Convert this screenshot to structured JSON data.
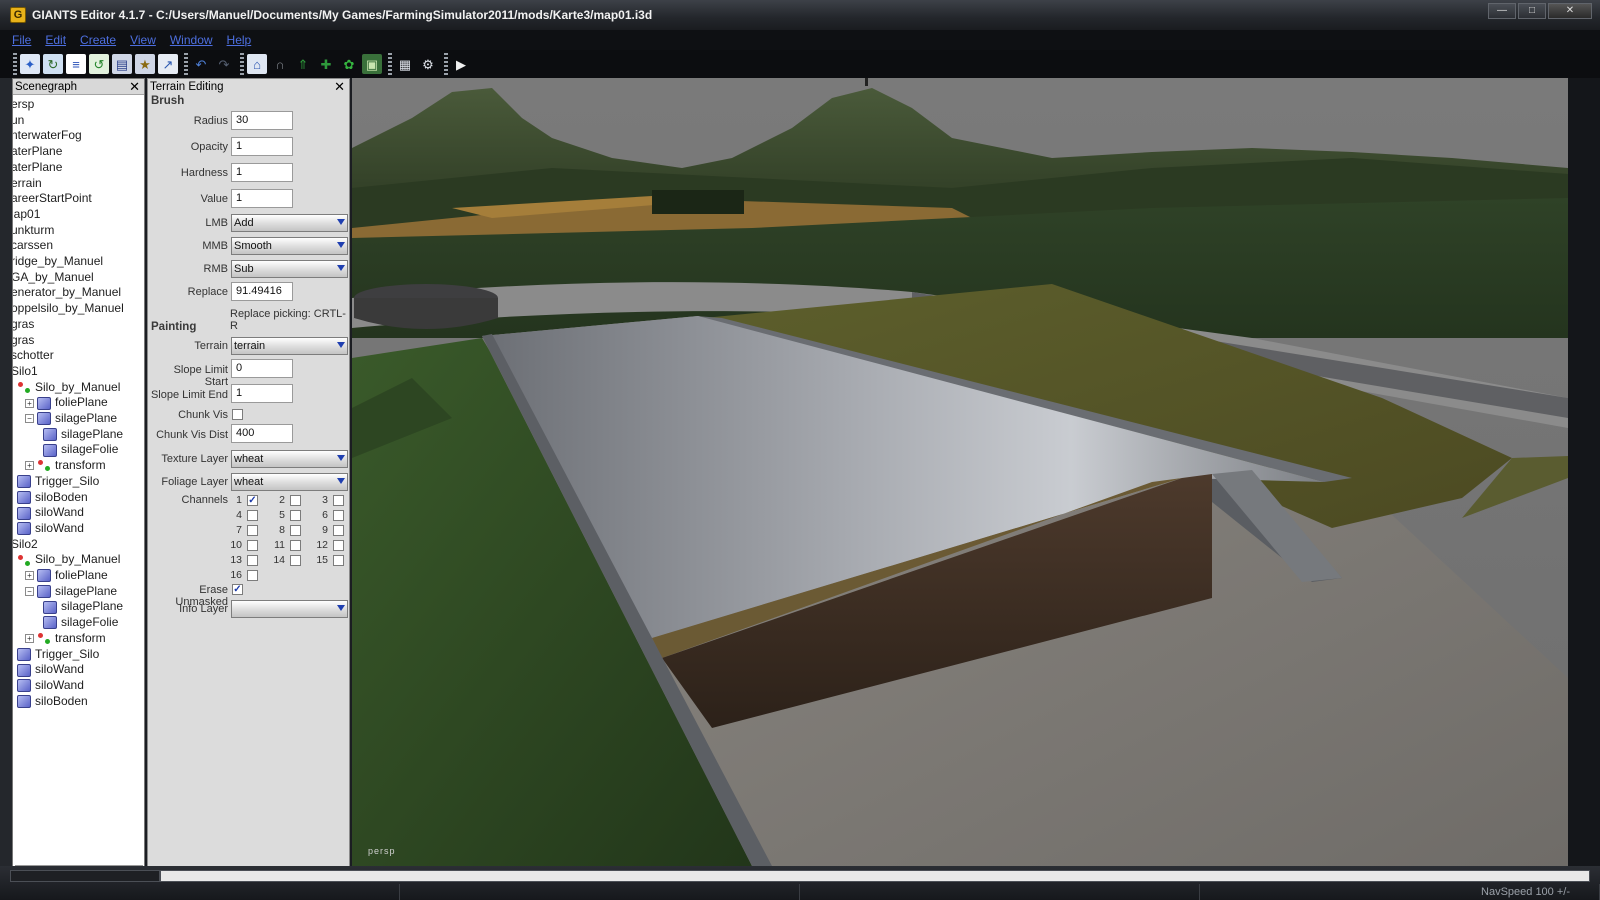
{
  "window": {
    "title": "GIANTS Editor 4.1.7 - C:/Users/Manuel/Documents/My Games/FarmingSimulator2011/mods/Karte3/map01.i3d",
    "app_icon": "giants-editor-icon"
  },
  "menu": [
    "File",
    "Edit",
    "Create",
    "View",
    "Window",
    "Help"
  ],
  "toolbar": {
    "icons": [
      "new-file-icon",
      "open-file-icon",
      "document-icon",
      "refresh-icon",
      "save-icon",
      "save-all-icon",
      "import-icon",
      "undo-icon",
      "redo-icon",
      "home-icon",
      "magnet-icon",
      "terrain-raise-icon",
      "terrain-lower-icon",
      "foliage-icon",
      "tractor-icon",
      "grid-icon",
      "settings-icon",
      "play-icon"
    ]
  },
  "scenegraph": {
    "title": "Scenegraph",
    "items": [
      {
        "label": "ersp",
        "icon": "",
        "depth": 0
      },
      {
        "label": "un",
        "icon": "",
        "depth": 0
      },
      {
        "label": "nterwaterFog",
        "icon": "",
        "depth": 0
      },
      {
        "label": "aterPlane",
        "icon": "",
        "depth": 0
      },
      {
        "label": "aterPlane",
        "icon": "",
        "depth": 0
      },
      {
        "label": "errain",
        "icon": "",
        "depth": 0
      },
      {
        "label": "areerStartPoint",
        "icon": "",
        "depth": 0
      },
      {
        "label": "lap01",
        "icon": "",
        "depth": 0
      },
      {
        "label": "unkturm",
        "icon": "",
        "depth": 0
      },
      {
        "label": "carssen",
        "icon": "",
        "depth": 0
      },
      {
        "label": "ridge_by_Manuel",
        "icon": "",
        "depth": 0
      },
      {
        "label": "GA_by_Manuel",
        "icon": "",
        "depth": 0
      },
      {
        "label": "enerator_by_Manuel",
        "icon": "",
        "depth": 0
      },
      {
        "label": "oppelsilo_by_Manuel",
        "icon": "",
        "depth": 0
      },
      {
        "label": "gras",
        "icon": "",
        "depth": 0
      },
      {
        "label": "gras",
        "icon": "",
        "depth": 0
      },
      {
        "label": "schotter",
        "icon": "",
        "depth": 0
      },
      {
        "label": "Silo1",
        "icon": "",
        "depth": 0
      },
      {
        "label": "Silo_by_Manuel",
        "icon": "transform-group-icon",
        "depth": 1
      },
      {
        "label": "foliePlane",
        "icon": "mesh-cube-icon",
        "depth": 2,
        "expander": "+"
      },
      {
        "label": "silagePlane",
        "icon": "mesh-cube-icon",
        "depth": 2,
        "expander": "-"
      },
      {
        "label": "silagePlane",
        "icon": "mesh-cube-icon",
        "depth": 3
      },
      {
        "label": "silageFolie",
        "icon": "mesh-cube-icon",
        "depth": 3
      },
      {
        "label": "transform",
        "icon": "transform-group-icon",
        "depth": 2,
        "expander": "+"
      },
      {
        "label": "Trigger_Silo",
        "icon": "mesh-cube-icon",
        "depth": 1
      },
      {
        "label": "siloBoden",
        "icon": "mesh-cube-icon",
        "depth": 1
      },
      {
        "label": "siloWand",
        "icon": "mesh-cube-icon",
        "depth": 1
      },
      {
        "label": "siloWand",
        "icon": "mesh-cube-icon",
        "depth": 1
      },
      {
        "label": "Silo2",
        "icon": "",
        "depth": 0
      },
      {
        "label": "Silo_by_Manuel",
        "icon": "transform-group-icon",
        "depth": 1
      },
      {
        "label": "foliePlane",
        "icon": "mesh-cube-icon",
        "depth": 2,
        "expander": "+"
      },
      {
        "label": "silagePlane",
        "icon": "mesh-cube-icon",
        "depth": 2,
        "expander": "-"
      },
      {
        "label": "silagePlane",
        "icon": "mesh-cube-icon",
        "depth": 3
      },
      {
        "label": "silageFolie",
        "icon": "mesh-cube-icon",
        "depth": 3
      },
      {
        "label": "transform",
        "icon": "transform-group-icon",
        "depth": 2,
        "expander": "+"
      },
      {
        "label": "Trigger_Silo",
        "icon": "mesh-cube-icon",
        "depth": 1
      },
      {
        "label": "siloWand",
        "icon": "mesh-cube-icon",
        "depth": 1
      },
      {
        "label": "siloWand",
        "icon": "mesh-cube-icon",
        "depth": 1
      },
      {
        "label": "siloBoden",
        "icon": "mesh-cube-icon",
        "depth": 1
      }
    ]
  },
  "terrain_editing": {
    "title": "Terrain Editing",
    "brush_title": "Brush",
    "radius_label": "Radius",
    "radius": "30",
    "opacity_label": "Opacity",
    "opacity": "1",
    "hardness_label": "Hardness",
    "hardness": "1",
    "value_label": "Value",
    "value": "1",
    "lmb_label": "LMB",
    "lmb": "Add",
    "mmb_label": "MMB",
    "mmb": "Smooth",
    "rmb_label": "RMB",
    "rmb": "Sub",
    "replace_label": "Replace",
    "replace": "91.49416",
    "replace_note": "Replace picking: CRTL-R",
    "painting_title": "Painting",
    "terrain_label": "Terrain",
    "terrain": "terrain",
    "slope_start_label": "Slope Limit Start",
    "slope_start": "0",
    "slope_end_label": "Slope Limit End",
    "slope_end": "1",
    "chunk_vis_label": "Chunk Vis",
    "chunk_vis_checked": false,
    "chunk_vis_dist_label": "Chunk Vis Dist",
    "chunk_vis_dist": "400",
    "texture_layer_label": "Texture Layer",
    "texture_layer": "wheat",
    "foliage_layer_label": "Foliage Layer",
    "foliage_layer": "wheat",
    "channels_label": "Channels",
    "channels": [
      {
        "n": "1",
        "checked": true
      },
      {
        "n": "2",
        "checked": false
      },
      {
        "n": "3",
        "checked": false
      },
      {
        "n": "4",
        "checked": false
      },
      {
        "n": "5",
        "checked": false
      },
      {
        "n": "6",
        "checked": false
      },
      {
        "n": "7",
        "checked": false
      },
      {
        "n": "8",
        "checked": false
      },
      {
        "n": "9",
        "checked": false
      },
      {
        "n": "10",
        "checked": false
      },
      {
        "n": "11",
        "checked": false
      },
      {
        "n": "12",
        "checked": false
      },
      {
        "n": "13",
        "checked": false
      },
      {
        "n": "14",
        "checked": false
      },
      {
        "n": "15",
        "checked": false
      },
      {
        "n": "16",
        "checked": false
      }
    ],
    "erase_unmasked_label": "Erase Unmasked",
    "erase_unmasked_checked": true,
    "info_layer_label": "Info Layer",
    "info_layer": ""
  },
  "viewport": {
    "camera_label": "persp"
  },
  "statusbar": {
    "nav_speed": "NavSpeed 100 +/-"
  }
}
